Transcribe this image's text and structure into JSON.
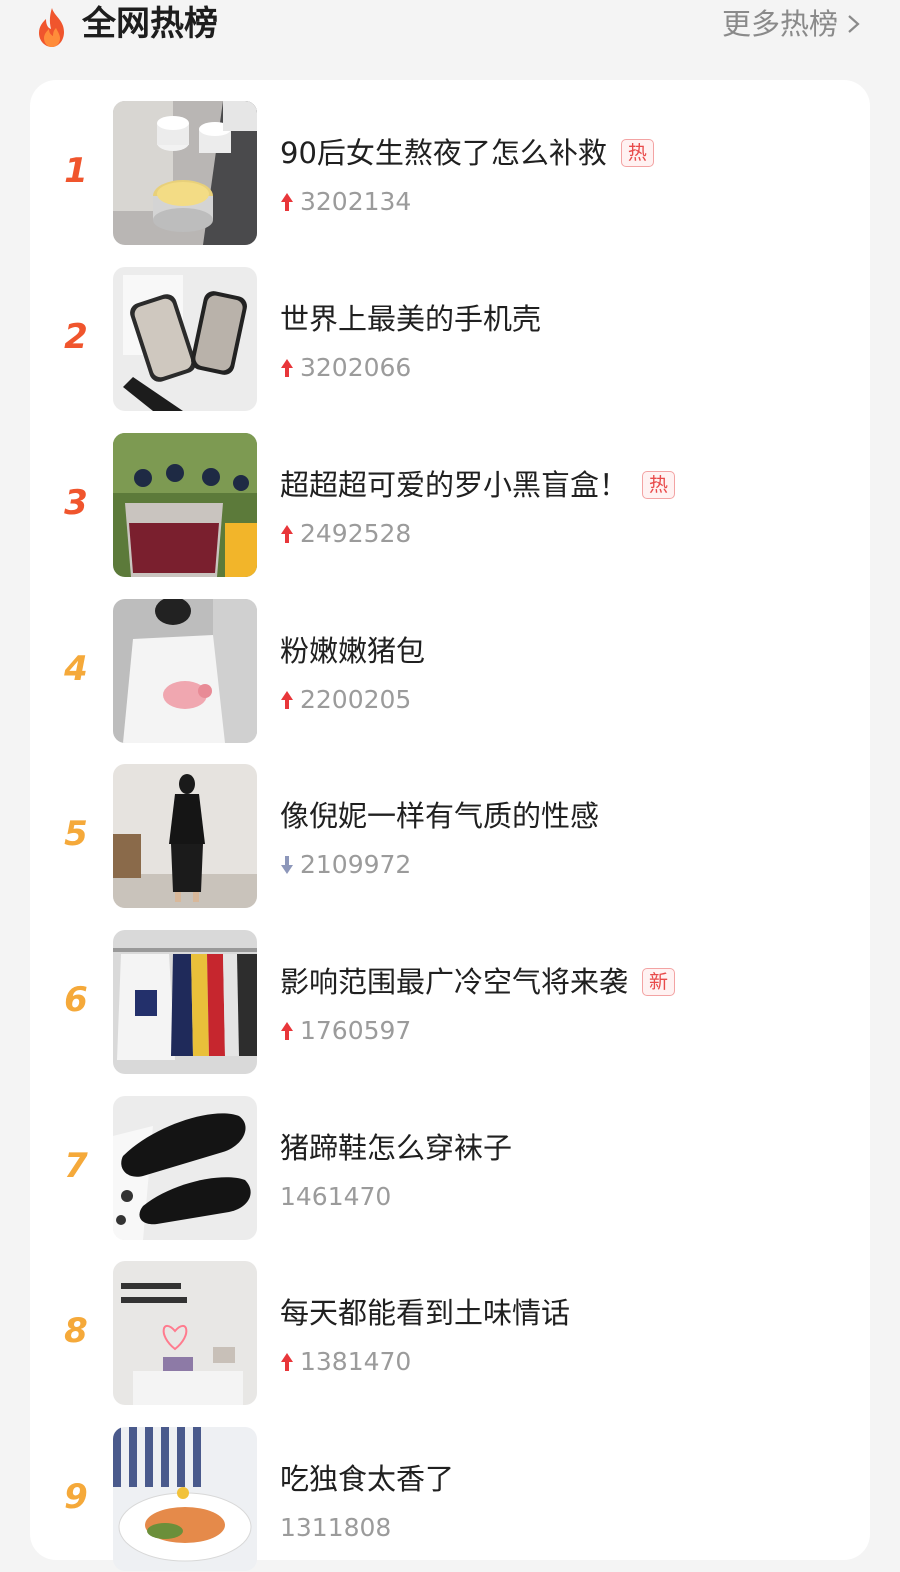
{
  "header": {
    "title": "全网热榜",
    "more_label": "更多热榜"
  },
  "colors": {
    "rank_top3": "#f0552d",
    "rank_rest": "#f5a93a",
    "up": "#e8363a",
    "down": "#8d97ba",
    "hot_tag": "#e84a4a"
  },
  "items": [
    {
      "rank": "1",
      "title": "90后女生熬夜了怎么补救",
      "tag": "热",
      "trend": "up",
      "count": "3202134"
    },
    {
      "rank": "2",
      "title": "世界上最美的手机壳",
      "tag": "",
      "trend": "up",
      "count": "3202066"
    },
    {
      "rank": "3",
      "title": "超超超可爱的罗小黑盲盒！",
      "tag": "热",
      "trend": "up",
      "count": "2492528"
    },
    {
      "rank": "4",
      "title": "粉嫩嫩猪包",
      "tag": "",
      "trend": "up",
      "count": "2200205"
    },
    {
      "rank": "5",
      "title": "像倪妮一样有气质的性感",
      "tag": "",
      "trend": "down",
      "count": "2109972"
    },
    {
      "rank": "6",
      "title": "影响范围最广冷空气将来袭",
      "tag": "新",
      "trend": "up",
      "count": "1760597"
    },
    {
      "rank": "7",
      "title": "猪蹄鞋怎么穿袜子",
      "tag": "",
      "trend": "none",
      "count": "1461470"
    },
    {
      "rank": "8",
      "title": "每天都能看到土味情话",
      "tag": "",
      "trend": "up",
      "count": "1381470"
    },
    {
      "rank": "9",
      "title": "吃独食太香了",
      "tag": "",
      "trend": "none",
      "count": "1311808"
    }
  ]
}
